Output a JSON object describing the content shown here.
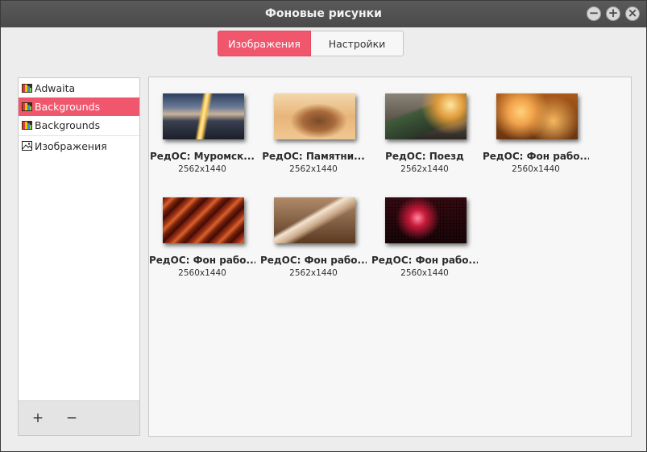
{
  "window": {
    "title": "Фоновые рисунки"
  },
  "window_buttons": {
    "minimize": "−",
    "maximize": "+",
    "close": "×"
  },
  "tabs": [
    {
      "label": "Изображения",
      "active": true
    },
    {
      "label": "Настройки",
      "active": false
    }
  ],
  "sidebar": {
    "items": [
      {
        "label": "Adwaita",
        "icon": "folder-colorful-icon",
        "selected": false
      },
      {
        "label": "Backgrounds",
        "icon": "folder-colorful-icon",
        "selected": true
      },
      {
        "label": "Backgrounds",
        "icon": "folder-colorful-icon",
        "selected": false
      },
      {
        "label": "Изображения",
        "icon": "image-icon",
        "selected": false
      }
    ],
    "add_label": "+",
    "remove_label": "−"
  },
  "wallpapers": [
    {
      "name": "РедОС: Муромск...",
      "resolution": "2562x1440",
      "theme": "city-dusk"
    },
    {
      "name": "РедОС: Памятни...",
      "resolution": "2562x1440",
      "theme": "monument"
    },
    {
      "name": "РедОС: Поезд",
      "resolution": "2562x1440",
      "theme": "train"
    },
    {
      "name": "РедОС: Фон рабо...",
      "resolution": "2560x1440",
      "theme": "orange-bokeh"
    },
    {
      "name": "РедОС: Фон рабо...",
      "resolution": "2560x1440",
      "theme": "red-streaks"
    },
    {
      "name": "РедОС: Фон рабо...",
      "resolution": "2562x1440",
      "theme": "beige-abstract"
    },
    {
      "name": "РедОС: Фон рабо...",
      "resolution": "2560x1440",
      "theme": "red-pixels"
    }
  ],
  "colors": {
    "accent": "#f0576d",
    "titlebar": "#4f4f4f"
  }
}
